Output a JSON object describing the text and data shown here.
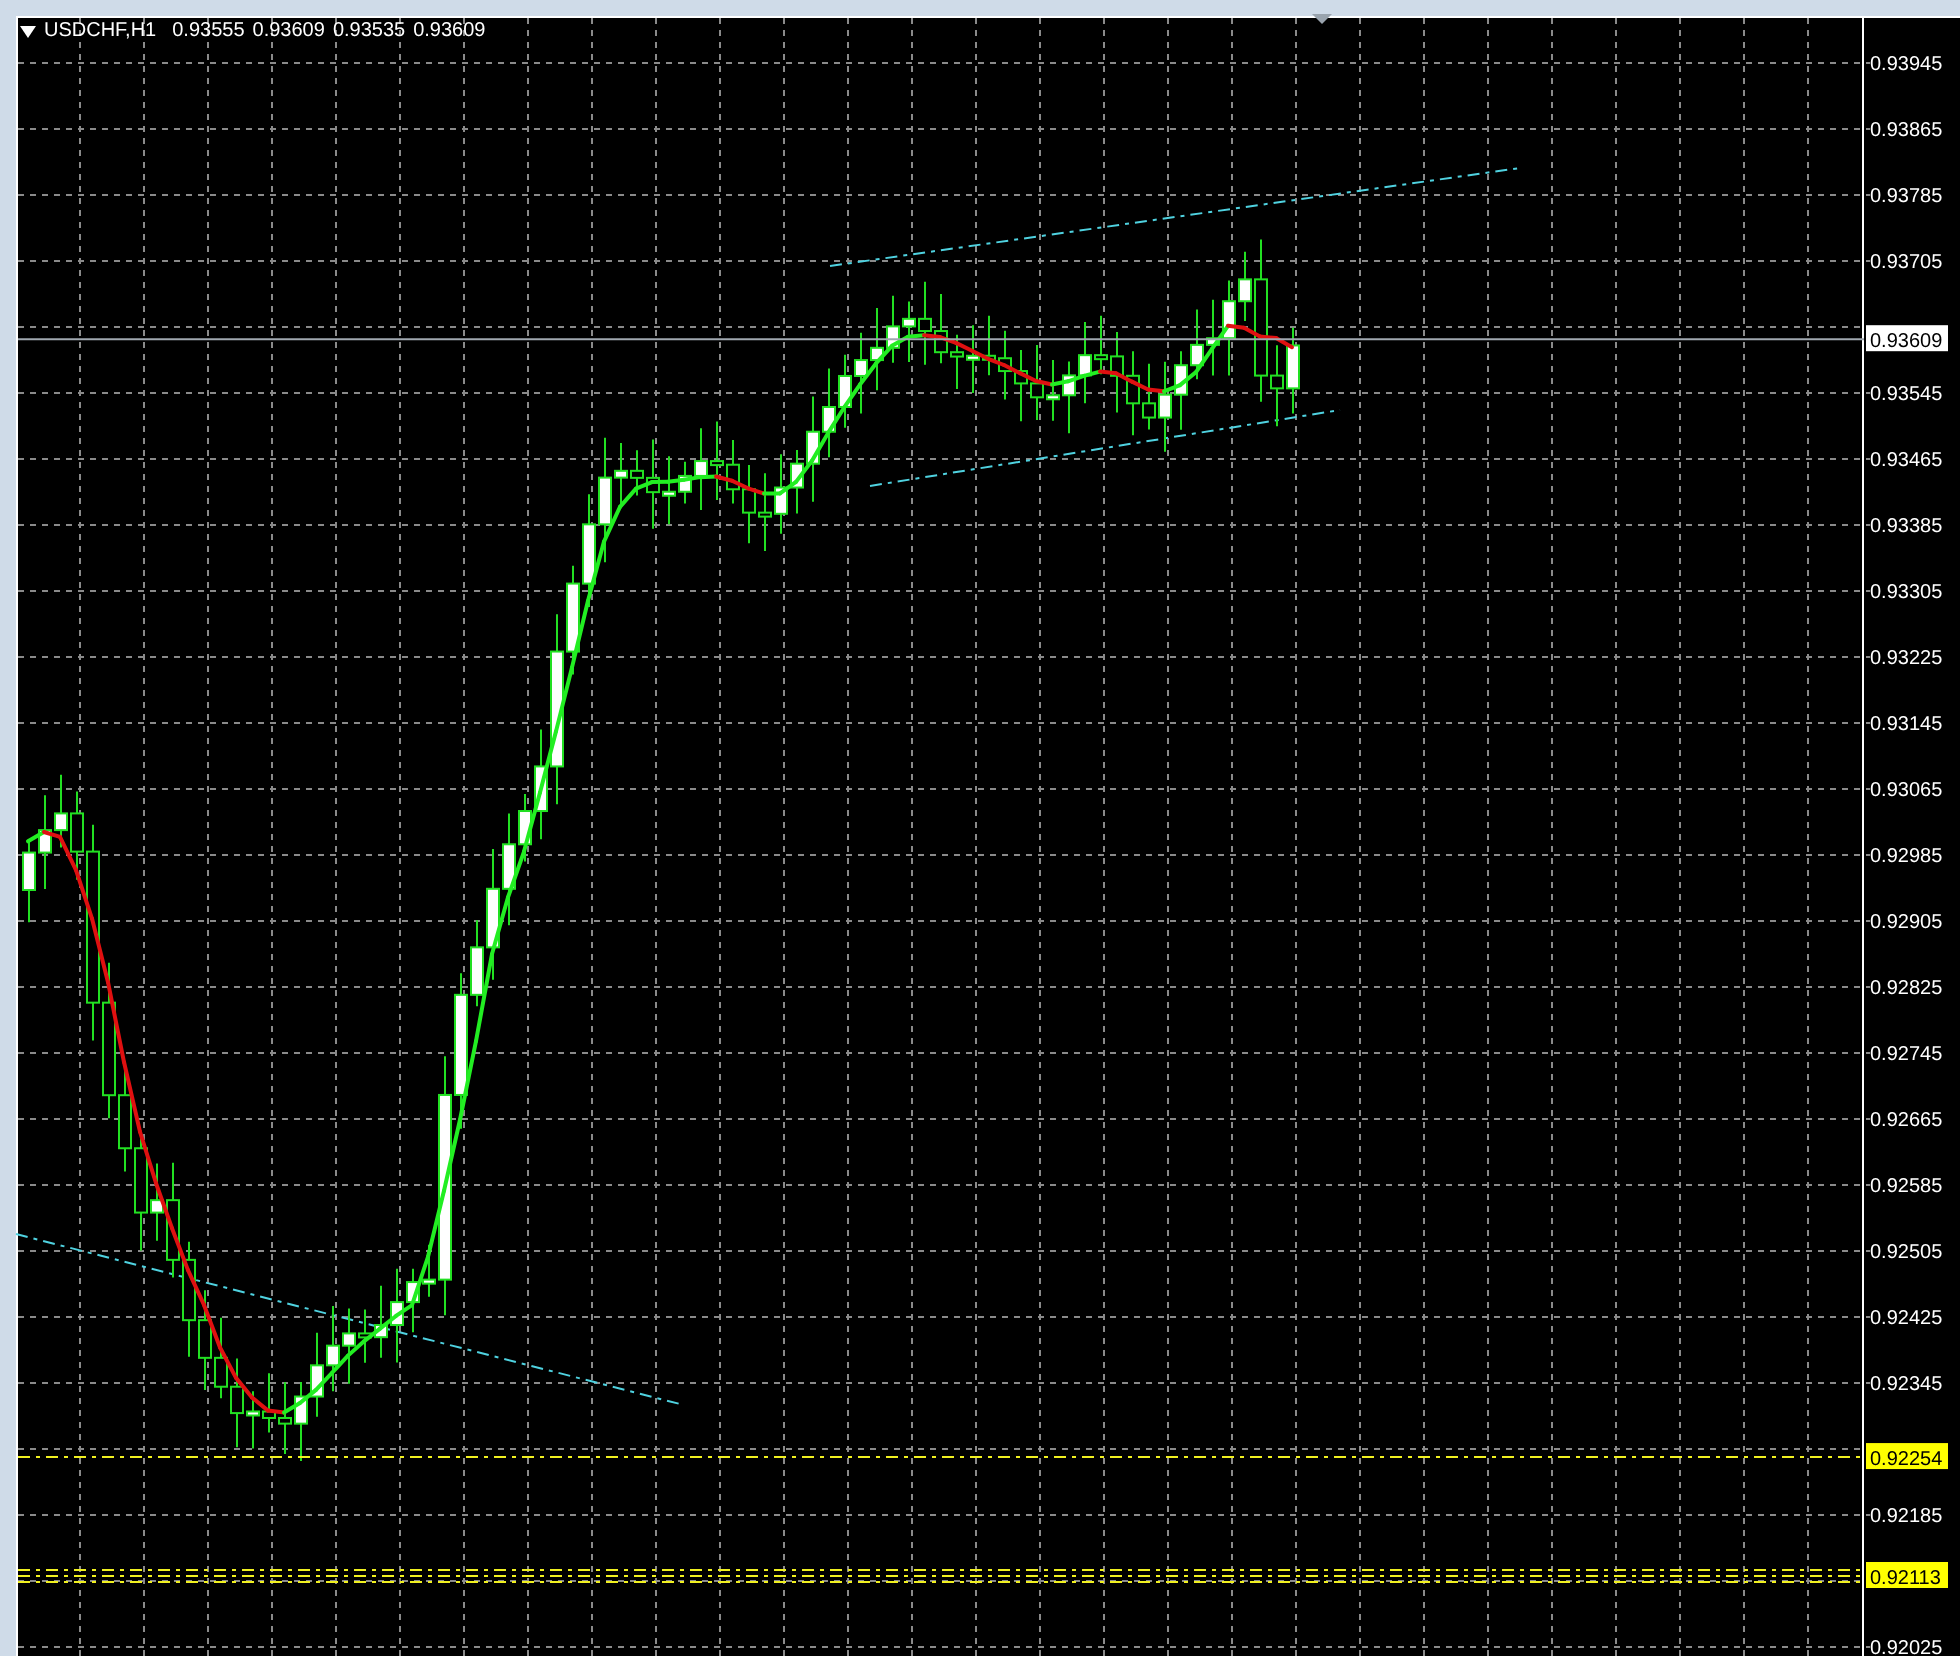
{
  "chart": {
    "symbol": "USDCHF,H1",
    "ohlc": [
      "0.93555",
      "0.93609",
      "0.93535",
      "0.93609"
    ]
  },
  "price_axis": {
    "labels": [
      "0.93945",
      "0.93865",
      "0.93785",
      "0.93705",
      "0.93545",
      "0.93465",
      "0.93385",
      "0.93305",
      "0.93225",
      "0.93145",
      "0.93065",
      "0.92985",
      "0.92905",
      "0.92825",
      "0.92745",
      "0.92665",
      "0.92585",
      "0.92505",
      "0.92425",
      "0.92345",
      "0.92185",
      "0.92025"
    ]
  },
  "price_markers": [
    {
      "label": "0.93609",
      "kind": "bid"
    },
    {
      "label": "0.92254",
      "kind": "level"
    },
    {
      "label": "0.92113",
      "kind": "level"
    }
  ]
}
